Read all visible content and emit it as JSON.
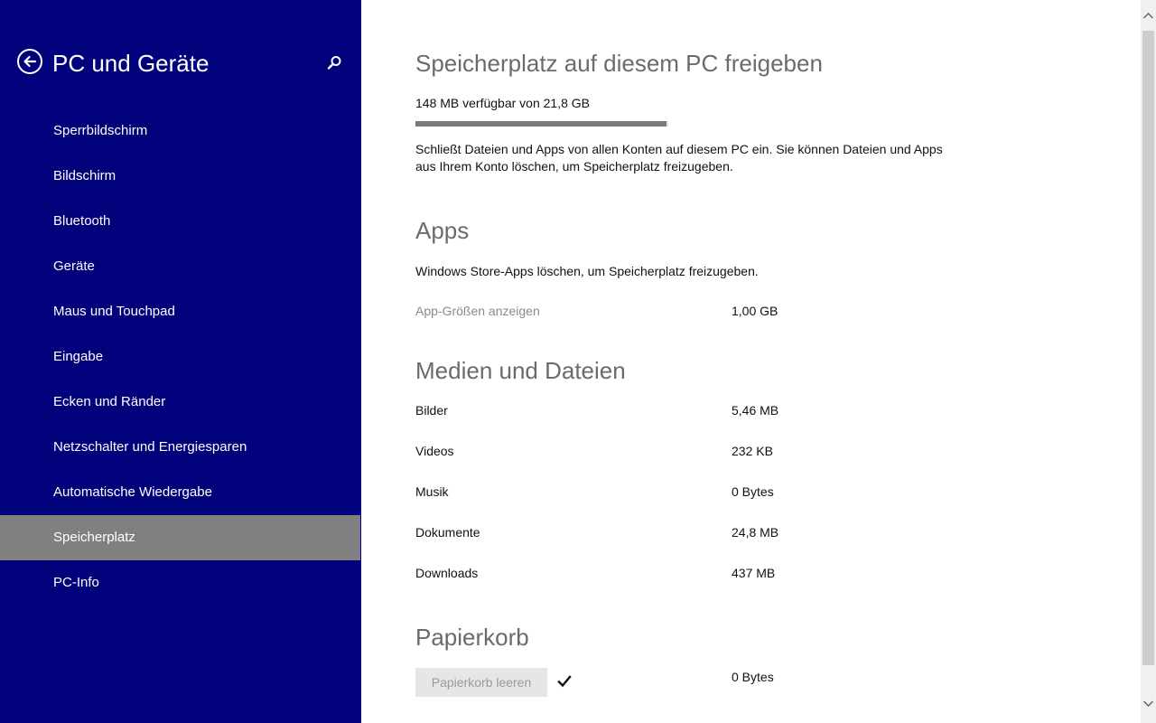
{
  "sidebar": {
    "title": "PC und Geräte",
    "back_icon": "back-arrow-icon",
    "search_icon": "search-icon",
    "items": [
      {
        "label": "Sperrbildschirm"
      },
      {
        "label": "Bildschirm"
      },
      {
        "label": "Bluetooth"
      },
      {
        "label": "Geräte"
      },
      {
        "label": "Maus und Touchpad"
      },
      {
        "label": "Eingabe"
      },
      {
        "label": "Ecken und Ränder"
      },
      {
        "label": "Netzschalter und Energiesparen"
      },
      {
        "label": "Automatische Wiedergabe"
      },
      {
        "label": "Speicherplatz",
        "selected": true
      },
      {
        "label": "PC-Info"
      }
    ],
    "colors": {
      "background": "#01017b",
      "selected": "#808080"
    }
  },
  "main": {
    "title": "Speicherplatz auf diesem PC freigeben",
    "storage": {
      "summary": "148 MB verfügbar von 21,8 GB",
      "used_fraction": 0.993
    },
    "description": "Schließt Dateien und Apps von allen Konten auf diesem PC ein. Sie können Dateien und Apps aus Ihrem Konto löschen, um Speicherplatz freizugeben.",
    "apps": {
      "heading": "Apps",
      "description": "Windows Store-Apps löschen, um Speicherplatz freizugeben.",
      "link_label": "App-Größen anzeigen",
      "size": "1,00 GB"
    },
    "media": {
      "heading": "Medien und Dateien",
      "rows": [
        {
          "label": "Bilder",
          "value": "5,46 MB"
        },
        {
          "label": "Videos",
          "value": "232 KB"
        },
        {
          "label": "Musik",
          "value": "0 Bytes"
        },
        {
          "label": "Dokumente",
          "value": "24,8 MB"
        },
        {
          "label": "Downloads",
          "value": "437 MB"
        }
      ]
    },
    "recycle": {
      "heading": "Papierkorb",
      "button_label": "Papierkorb leeren",
      "check_icon": "checkmark-icon",
      "value": "0 Bytes"
    }
  },
  "scrollbar": {
    "up_icon": "scroll-up-arrow-icon",
    "down_icon": "scroll-down-arrow-icon"
  }
}
